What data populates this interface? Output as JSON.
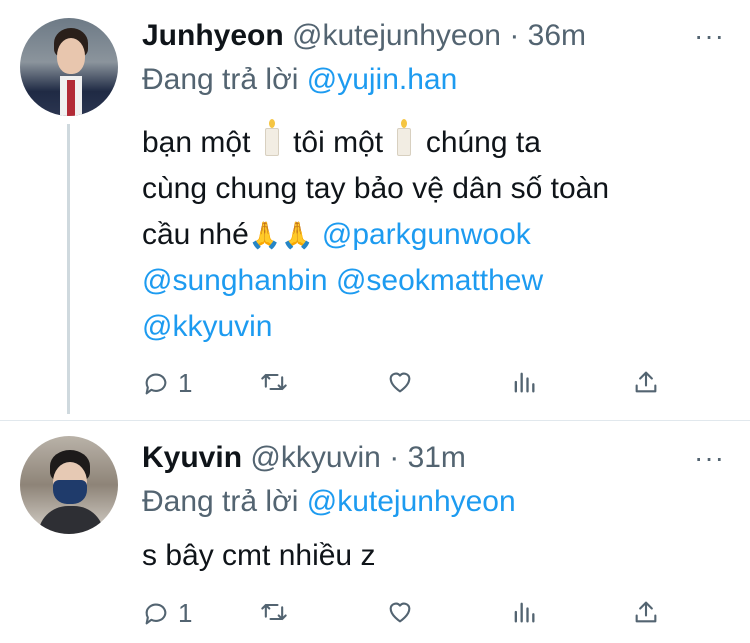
{
  "tweets": [
    {
      "name": "Junhyeon",
      "handle": "@kutejunhyeon",
      "dot": "·",
      "time": "36m",
      "reply_prefix": "Đang trả lời",
      "reply_to": "@yujin.han",
      "text_line1_a": "bạn một",
      "text_line1_b": "tôi một",
      "text_line1_c": "chúng ta",
      "text_line2": "cùng chung tay bảo vệ dân số toàn",
      "text_line3": "cầu nhé",
      "pray_emoji": "🙏🙏",
      "mentions": [
        "@parkgunwook",
        "@sunghanbin",
        "@seokmatthew",
        "@kkyuvin"
      ],
      "reply_count": "1",
      "avatar_icon": "profile-photo-student-uniform"
    },
    {
      "name": "Kyuvin",
      "handle": "@kkyuvin",
      "dot": "·",
      "time": "31m",
      "reply_prefix": "Đang trả lời",
      "reply_to": "@kutejunhyeon",
      "text": "s bây cmt nhiều z",
      "reply_count": "1",
      "avatar_icon": "profile-photo-masked"
    }
  ],
  "more_label": "···",
  "icons": [
    "reply-icon",
    "retweet-icon",
    "like-icon",
    "analytics-icon",
    "share-icon",
    "more-icon"
  ],
  "colors": {
    "accent": "#1d9bf0",
    "secondary_text": "#536471",
    "primary_text": "#0f1419",
    "thread_line": "#cfd9de"
  }
}
